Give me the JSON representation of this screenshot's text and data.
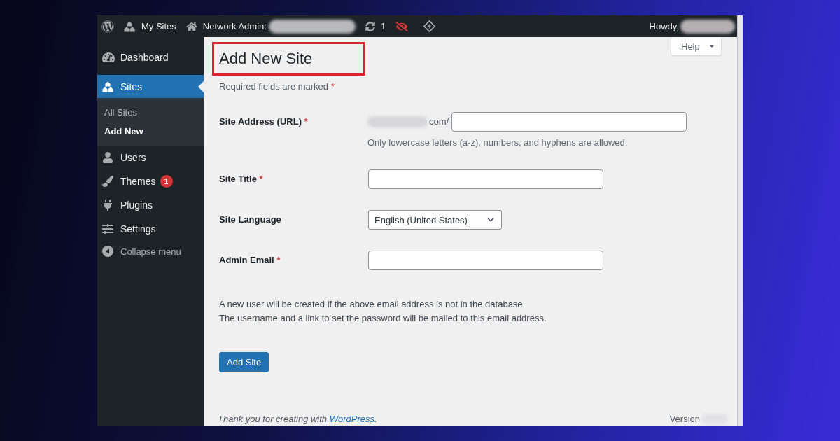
{
  "admin_bar": {
    "my_sites": {
      "label": "My Sites"
    },
    "network_admin": {
      "label": "Network Admin:",
      "name_redacted": true
    },
    "updates": {
      "count": "1"
    },
    "account": {
      "greeting": "Howdy,",
      "name_redacted": true
    }
  },
  "sidebar": {
    "items": [
      {
        "label": "Dashboard",
        "selected": false
      },
      {
        "label": "Sites",
        "selected": true,
        "children": [
          {
            "label": "All Sites",
            "selected": false
          },
          {
            "label": "Add New",
            "selected": true
          }
        ]
      },
      {
        "label": "Users",
        "selected": false
      },
      {
        "label": "Themes",
        "selected": false,
        "badge": "1"
      },
      {
        "label": "Plugins",
        "selected": false
      },
      {
        "label": "Settings",
        "selected": false
      }
    ],
    "collapse": {
      "label": "Collapse menu"
    }
  },
  "page": {
    "title": "Add New Site",
    "highlighted": true,
    "help_button": {
      "label": "Help"
    },
    "required_note": {
      "text": "Required fields are marked",
      "mark": "*"
    }
  },
  "form": {
    "fields": [
      {
        "kind": "address",
        "label": "Site Address (URL)",
        "required_mark": "*",
        "prefix_redacted": true,
        "prefix": "com/",
        "description": "Only lowercase letters (a-z), numbers, and hyphens are allowed."
      },
      {
        "kind": "input",
        "label": "Site Title",
        "required_mark": "*"
      },
      {
        "kind": "select",
        "label": "Site Language",
        "value": "English (United States)"
      },
      {
        "kind": "input",
        "label": "Admin Email",
        "required_mark": "*"
      }
    ],
    "notes": [
      "A new user will be created if the above email address is not in the database.",
      "The username and a link to set the password will be mailed to this email address."
    ],
    "submit_button": {
      "label": "Add Site"
    }
  },
  "footer": {
    "thanks": {
      "text": "Thank you for creating with",
      "link": "WordPress",
      "after": "."
    },
    "version": {
      "label": "Version",
      "number_redacted": true
    }
  }
}
